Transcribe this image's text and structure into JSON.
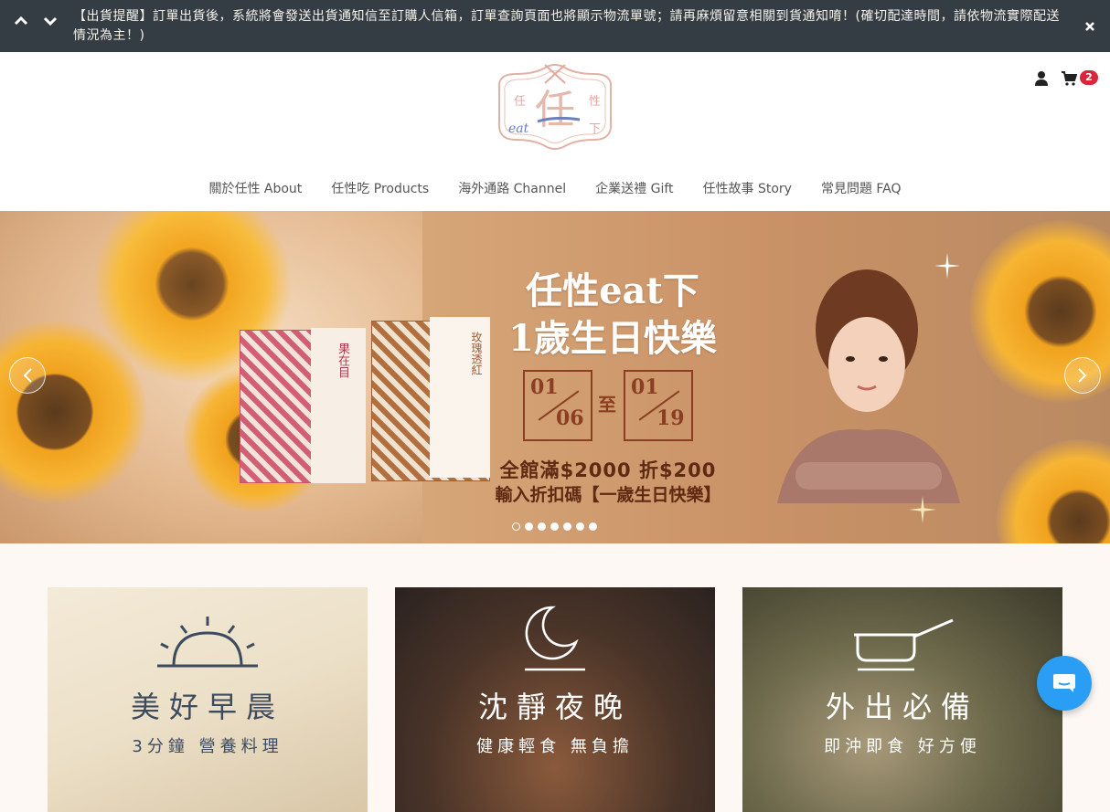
{
  "announcement": {
    "text": "【出貨提醒】訂單出貨後，系統將會發送出貨通知信至訂購人信箱，訂單查詢頁面也將顯示物流單號；請再麻煩留意相關到貨通知唷！(確切配達時間，請依物流實際配送情況為主！)",
    "icons": [
      "chevron-up-icon",
      "chevron-down-icon",
      "close-icon"
    ]
  },
  "logo": {
    "chars": [
      "任",
      "性",
      "eat",
      "下"
    ],
    "main_char": "任",
    "colors": {
      "primary": "#e0a9a0",
      "accent": "#6b7fbf"
    }
  },
  "header": {
    "cart_count": "2",
    "icons": [
      "user-icon",
      "cart-icon"
    ]
  },
  "nav": {
    "items": [
      {
        "label": "關於任性 About"
      },
      {
        "label": "任性吃 Products"
      },
      {
        "label": "海外通路 Channel"
      },
      {
        "label": "企業送禮 Gift"
      },
      {
        "label": "任性故事 Story"
      },
      {
        "label": "常見問題 FAQ"
      }
    ]
  },
  "hero": {
    "title_line1": "任性eat下",
    "title_line2": "1歲生日快樂",
    "date_from_month": "01",
    "date_from_day": "06",
    "date_to_label": "至",
    "date_to_month": "01",
    "date_to_day": "19",
    "promo_line1": "全館滿$2000 折$200",
    "promo_line2": "輸入折扣碼【一歲生日快樂】",
    "box1_label": "果在目",
    "box2_label": "玫瑰透紅",
    "slide_count": 7,
    "active_slide": 1
  },
  "cards": [
    {
      "title": "美好早晨",
      "subtitle": "3分鐘 營養料理",
      "icon": "sunrise-icon",
      "text_color": "#3d4b5e"
    },
    {
      "title": "沈靜夜晚",
      "subtitle": "健康輕食 無負擔",
      "icon": "moon-icon",
      "text_color": "#ffffff"
    },
    {
      "title": "外出必備",
      "subtitle": "即沖即食 好方便",
      "icon": "pot-icon",
      "text_color": "#ffffff"
    }
  ],
  "chat": {
    "icon": "chat-icon",
    "color": "#2a9df4"
  }
}
